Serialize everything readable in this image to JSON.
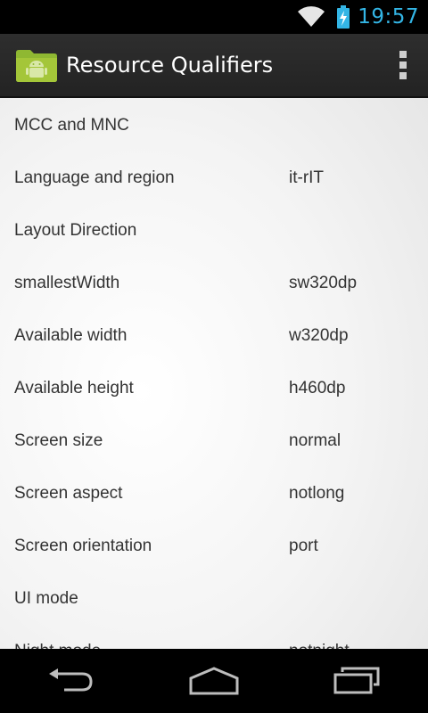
{
  "status_bar": {
    "time": "19:57",
    "icons": [
      "wifi-icon",
      "battery-charging-icon"
    ],
    "accent_color": "#33b5e5"
  },
  "action_bar": {
    "title": "Resource Qualifiers",
    "icons": [
      "android-folder-icon",
      "overflow-menu-icon"
    ]
  },
  "rows": [
    {
      "label": "MCC and MNC",
      "value": ""
    },
    {
      "label": "Language and region",
      "value": "it-rIT"
    },
    {
      "label": "Layout Direction",
      "value": ""
    },
    {
      "label": "smallestWidth",
      "value": "sw320dp"
    },
    {
      "label": "Available width",
      "value": "w320dp"
    },
    {
      "label": "Available height",
      "value": "h460dp"
    },
    {
      "label": "Screen size",
      "value": "normal"
    },
    {
      "label": "Screen aspect",
      "value": "notlong"
    },
    {
      "label": "Screen orientation",
      "value": "port"
    },
    {
      "label": "UI mode",
      "value": ""
    },
    {
      "label": "Night mode",
      "value": "notnight"
    }
  ],
  "nav_bar": {
    "icons": [
      "back-icon",
      "home-icon",
      "recent-apps-icon"
    ]
  }
}
